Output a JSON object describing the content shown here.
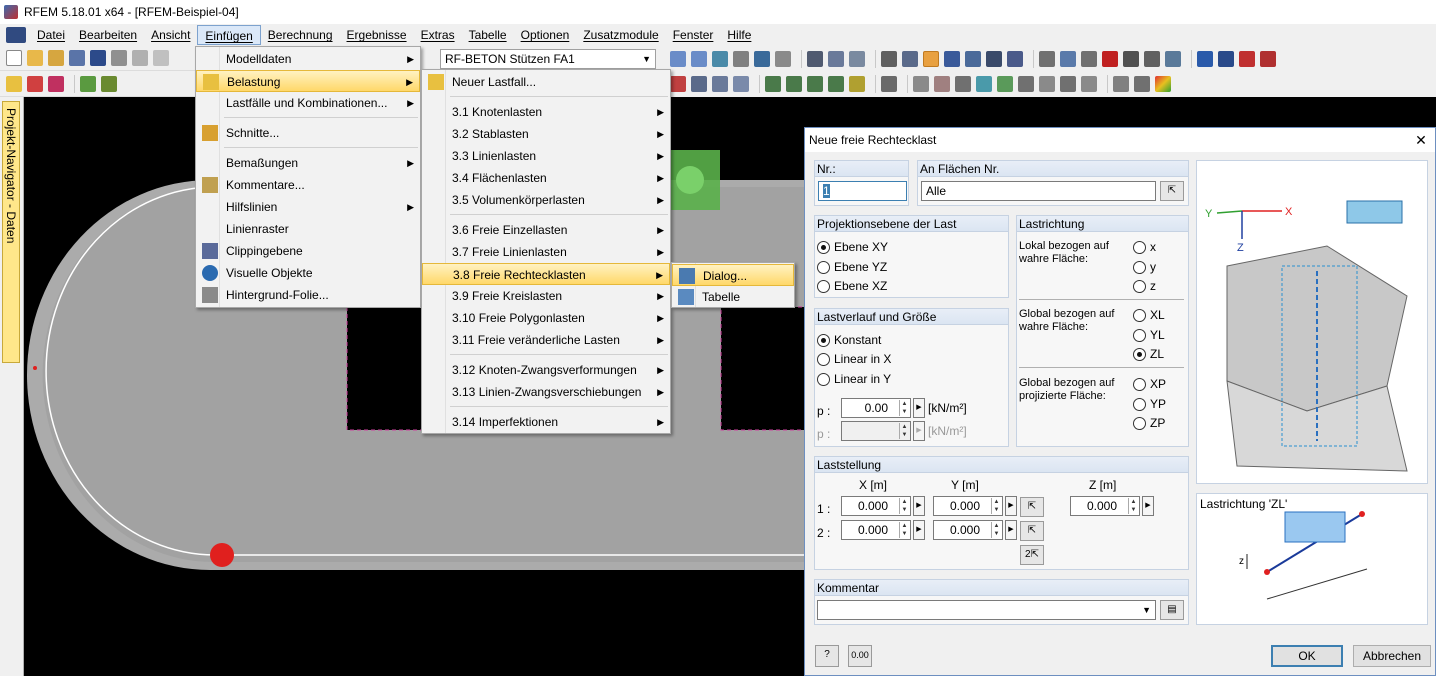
{
  "window": {
    "title": "RFEM 5.18.01 x64 - [RFEM-Beispiel-04]"
  },
  "menubar": {
    "items": [
      "Datei",
      "Bearbeiten",
      "Ansicht",
      "Einfügen",
      "Berechnung",
      "Ergebnisse",
      "Extras",
      "Tabelle",
      "Optionen",
      "Zusatzmodule",
      "Fenster",
      "Hilfe"
    ],
    "active": "Einfügen"
  },
  "toolbar": {
    "loadcase_combo": "RF-BETON Stützen FA1"
  },
  "navigator": {
    "tab_label": "Projekt-Navigator - Daten"
  },
  "menu_einfuegen": {
    "items": [
      "Modelldaten",
      "Belastung",
      "Lastfälle und Kombinationen...",
      "Schnitte...",
      "Bemaßungen",
      "Kommentare...",
      "Hilfslinien",
      "Linienraster",
      "Clippingebene",
      "Visuelle Objekte",
      "Hintergrund-Folie..."
    ],
    "highlighted": "Belastung"
  },
  "menu_belastung": {
    "items": [
      "Neuer Lastfall...",
      "3.1 Knotenlasten",
      "3.2 Stablasten",
      "3.3 Linienlasten",
      "3.4 Flächenlasten",
      "3.5 Volumenkörperlasten",
      "3.6 Freie Einzellasten",
      "3.7 Freie Linienlasten",
      "3.8 Freie Rechtecklasten",
      "3.9 Freie Kreislasten",
      "3.10 Freie Polygonlasten",
      "3.11 Freie veränderliche Lasten",
      "3.12 Knoten-Zwangsverformungen",
      "3.13 Linien-Zwangsverschiebungen",
      "3.14 Imperfektionen"
    ],
    "highlighted": "3.8 Freie Rechtecklasten"
  },
  "menu_rechteck": {
    "items": [
      "Dialog...",
      "Tabelle"
    ],
    "highlighted": "Dialog..."
  },
  "dialog": {
    "title": "Neue freie Rechtecklast",
    "close": "✕",
    "nr_label": "Nr.:",
    "nr_value": "1",
    "flaechen_label": "An Flächen Nr.",
    "flaechen_value": "Alle",
    "proj_header": "Projektionsebene der Last",
    "proj_options": [
      "Ebene XY",
      "Ebene YZ",
      "Ebene XZ"
    ],
    "proj_selected": "Ebene XY",
    "richtung_header": "Lastrichtung",
    "richtung_lokal_label": "Lokal bezogen auf wahre Fläche:",
    "richtung_lokal": [
      "x",
      "y",
      "z"
    ],
    "richtung_global_label": "Global bezogen auf wahre Fläche:",
    "richtung_global": [
      "XL",
      "YL",
      "ZL"
    ],
    "richtung_proj_label": "Global bezogen auf projizierte Fläche:",
    "richtung_proj": [
      "XP",
      "YP",
      "ZP"
    ],
    "richtung_selected": "ZL",
    "verlauf_header": "Lastverlauf und Größe",
    "verlauf_options": [
      "Konstant",
      "Linear in X",
      "Linear in Y"
    ],
    "verlauf_selected": "Konstant",
    "p_label": "p :",
    "p_value": "0.00",
    "p_unit": "[kN/m²]",
    "p2_label": "p :",
    "p2_value": "",
    "p2_unit": "[kN/m²]",
    "stellung_header": "Laststellung",
    "col_x": "X  [m]",
    "col_y": "Y  [m]",
    "col_z": "Z  [m]",
    "row1_label": "1 :",
    "row2_label": "2 :",
    "x1": "0.000",
    "y1": "0.000",
    "z1": "0.000",
    "x2": "0.000",
    "y2": "0.000",
    "pick_12_label": "2",
    "img_caption": "Lastrichtung 'ZL'",
    "kommentar_header": "Kommentar",
    "kommentar_value": "",
    "ok": "OK",
    "cancel": "Abbrechen",
    "units_btn": "0.00"
  },
  "colors": {
    "selection_yellow": "#ffd86a",
    "model_grey": "#a8a8a8",
    "node_red": "#e0201e",
    "accent_blue": "#3c7fb1"
  }
}
